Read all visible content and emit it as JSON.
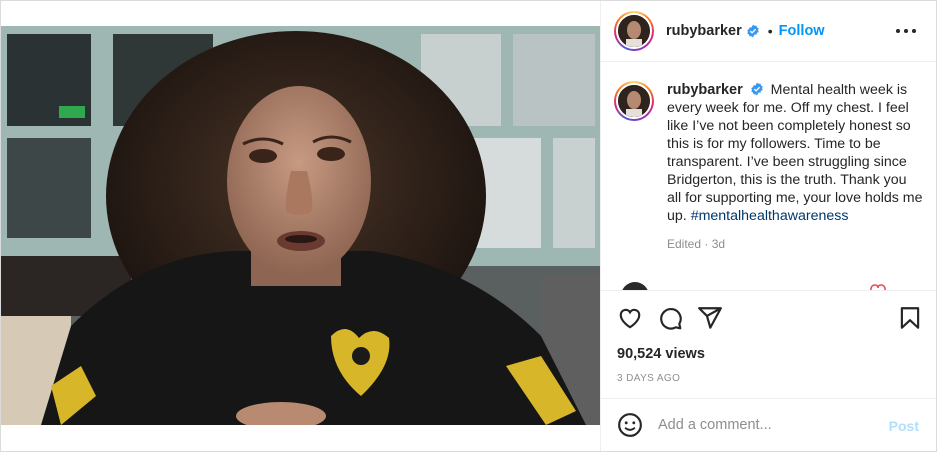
{
  "post": {
    "author": "rubybarker",
    "verified": true,
    "follow_label": "Follow",
    "separator": "•",
    "caption": "Mental health week is every week for me. Off my chest. I feel like I’ve not been completely honest so this is for my followers. Time to be transparent. I’ve been struggling since Bridgerton, this is the truth. Thank you all for supporting me, your love holds me up.",
    "hashtag": "#mentalhealthawareness",
    "edited": "Edited · 3d",
    "views": "90,524 views",
    "time_ago": "3 DAYS AGO"
  },
  "comment_box": {
    "placeholder": "Add a comment...",
    "post_label": "Post"
  },
  "icons": {
    "verified": "verified-badge-icon",
    "more": "more-options-icon",
    "like": "heart-icon",
    "comment": "comment-bubble-icon",
    "share": "paper-plane-icon",
    "save": "bookmark-icon",
    "emoji": "smiley-icon"
  },
  "colors": {
    "link_blue": "#0095f6",
    "hashtag": "#00376b",
    "post_disabled": "#b2dffc",
    "muted_text": "#8e8e8e",
    "verified": "#3897f0"
  }
}
